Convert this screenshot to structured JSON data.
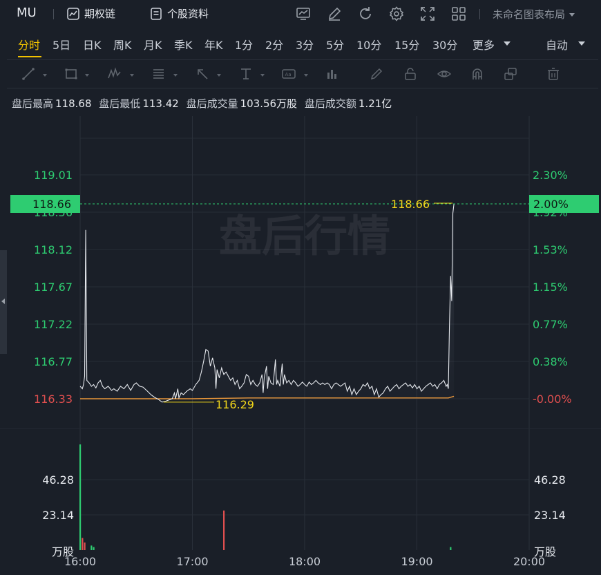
{
  "header": {
    "ticker": "MU",
    "options_chain_label": "期权链",
    "profile_label": "个股资料",
    "layout_name": "未命名图表布局"
  },
  "periods": {
    "tabs": [
      "分时",
      "5日",
      "日K",
      "周K",
      "月K",
      "季K",
      "年K",
      "1分",
      "2分",
      "3分",
      "5分",
      "10分",
      "15分",
      "30分",
      "更多"
    ],
    "active": "分时",
    "auto_label": "自动"
  },
  "drawing_tools": [
    "line-tool",
    "rect-tool",
    "wave-tool",
    "fib-tool",
    "arrow-tool",
    "text-tool",
    "label-tool",
    "bar-tool",
    "pen-tool",
    "lock-tool",
    "eye-tool",
    "magnet-tool",
    "layers-tool",
    "trash-tool"
  ],
  "info": {
    "high_label": "盘后最高",
    "high": "118.68",
    "low_label": "盘后最低",
    "low": "113.42",
    "vol_label": "盘后成交量",
    "vol": "103.56万股",
    "amount_label": "盘后成交额",
    "amount": "1.21亿"
  },
  "watermark": "盘后行情",
  "colors": {
    "up": "#2ecc71",
    "down": "#e04f4f",
    "price_line": "#e6e9ee",
    "avg_line": "#e8963a",
    "marker": "#f2d71a"
  },
  "chart_data": {
    "type": "line",
    "x_ticks": [
      "16:00",
      "17:00",
      "18:00",
      "19:00",
      "20:00"
    ],
    "x_range_hours": [
      16,
      20
    ],
    "price_axis": {
      "min": 116.33,
      "max": 119.01,
      "ticks": [
        "119.01",
        "118.56",
        "118.12",
        "117.67",
        "117.22",
        "116.77",
        "116.33"
      ],
      "pct_ticks": [
        "2.30%",
        "1.92%",
        "1.53%",
        "1.15%",
        "0.77%",
        "0.38%",
        "-0.00%"
      ],
      "pct_max": 2.3
    },
    "current_price": "118.66",
    "current_pct": "2.00%",
    "high_marker": "118.66",
    "low_marker": "116.29",
    "price_series": [
      [
        16.0,
        116.48
      ],
      [
        16.02,
        116.45
      ],
      [
        16.03,
        116.5
      ],
      [
        16.04,
        116.6
      ],
      [
        16.05,
        118.35
      ],
      [
        16.06,
        116.55
      ],
      [
        16.08,
        116.52
      ],
      [
        16.1,
        116.48
      ],
      [
        16.12,
        116.5
      ],
      [
        16.14,
        116.46
      ],
      [
        16.16,
        116.52
      ],
      [
        16.18,
        116.55
      ],
      [
        16.2,
        116.48
      ],
      [
        16.22,
        116.45
      ],
      [
        16.25,
        116.48
      ],
      [
        16.28,
        116.43
      ],
      [
        16.3,
        116.45
      ],
      [
        16.33,
        116.42
      ],
      [
        16.36,
        116.48
      ],
      [
        16.39,
        116.45
      ],
      [
        16.42,
        116.5
      ],
      [
        16.45,
        116.43
      ],
      [
        16.48,
        116.5
      ],
      [
        16.5,
        116.52
      ],
      [
        16.53,
        116.48
      ],
      [
        16.56,
        116.47
      ],
      [
        16.6,
        116.42
      ],
      [
        16.63,
        116.38
      ],
      [
        16.66,
        116.35
      ],
      [
        16.7,
        116.32
      ],
      [
        16.73,
        116.29
      ],
      [
        16.76,
        116.3
      ],
      [
        16.8,
        116.32
      ],
      [
        16.82,
        116.33
      ],
      [
        16.84,
        116.4
      ],
      [
        16.85,
        116.33
      ],
      [
        16.87,
        116.45
      ],
      [
        16.88,
        116.34
      ],
      [
        16.9,
        116.4
      ],
      [
        16.92,
        116.38
      ],
      [
        16.95,
        116.42
      ],
      [
        16.98,
        116.45
      ],
      [
        17.0,
        116.43
      ],
      [
        17.03,
        116.5
      ],
      [
        17.06,
        116.55
      ],
      [
        17.08,
        116.65
      ],
      [
        17.1,
        116.78
      ],
      [
        17.12,
        116.92
      ],
      [
        17.14,
        116.9
      ],
      [
        17.16,
        116.72
      ],
      [
        17.18,
        116.82
      ],
      [
        17.2,
        116.7
      ],
      [
        17.21,
        116.45
      ],
      [
        17.22,
        116.68
      ],
      [
        17.24,
        116.58
      ],
      [
        17.26,
        116.7
      ],
      [
        17.28,
        116.62
      ],
      [
        17.3,
        116.65
      ],
      [
        17.32,
        116.6
      ],
      [
        17.34,
        116.55
      ],
      [
        17.36,
        116.58
      ],
      [
        17.38,
        116.5
      ],
      [
        17.4,
        116.55
      ],
      [
        17.42,
        116.45
      ],
      [
        17.44,
        116.48
      ],
      [
        17.46,
        116.52
      ],
      [
        17.48,
        116.62
      ],
      [
        17.5,
        116.6
      ],
      [
        17.52,
        116.5
      ],
      [
        17.54,
        116.55
      ],
      [
        17.56,
        116.5
      ],
      [
        17.58,
        116.48
      ],
      [
        17.6,
        116.52
      ],
      [
        17.62,
        116.62
      ],
      [
        17.63,
        116.4
      ],
      [
        17.64,
        116.58
      ],
      [
        17.66,
        116.72
      ],
      [
        17.67,
        116.45
      ],
      [
        17.68,
        116.6
      ],
      [
        17.7,
        116.52
      ],
      [
        17.72,
        116.5
      ],
      [
        17.74,
        116.8
      ],
      [
        17.75,
        116.5
      ],
      [
        17.76,
        116.55
      ],
      [
        17.78,
        116.48
      ],
      [
        17.8,
        116.75
      ],
      [
        17.81,
        116.5
      ],
      [
        17.82,
        116.62
      ],
      [
        17.84,
        116.52
      ],
      [
        17.86,
        116.55
      ],
      [
        17.88,
        116.5
      ],
      [
        17.9,
        116.55
      ],
      [
        17.92,
        116.52
      ],
      [
        17.94,
        116.48
      ],
      [
        17.96,
        116.5
      ],
      [
        17.98,
        116.53
      ],
      [
        18.0,
        116.5
      ],
      [
        18.02,
        116.48
      ],
      [
        18.04,
        116.53
      ],
      [
        18.06,
        116.5
      ],
      [
        18.08,
        116.52
      ],
      [
        18.1,
        116.55
      ],
      [
        18.12,
        116.52
      ],
      [
        18.14,
        116.5
      ],
      [
        18.16,
        116.52
      ],
      [
        18.18,
        116.5
      ],
      [
        18.2,
        116.52
      ],
      [
        18.22,
        116.5
      ],
      [
        18.24,
        116.45
      ],
      [
        18.26,
        116.5
      ],
      [
        18.28,
        116.52
      ],
      [
        18.3,
        116.5
      ],
      [
        18.32,
        116.48
      ],
      [
        18.34,
        116.5
      ],
      [
        18.36,
        116.52
      ],
      [
        18.38,
        116.42
      ],
      [
        18.4,
        116.48
      ],
      [
        18.42,
        116.38
      ],
      [
        18.44,
        116.45
      ],
      [
        18.46,
        116.38
      ],
      [
        18.48,
        116.42
      ],
      [
        18.5,
        116.45
      ],
      [
        18.52,
        116.5
      ],
      [
        18.54,
        116.48
      ],
      [
        18.56,
        116.52
      ],
      [
        18.58,
        116.45
      ],
      [
        18.6,
        116.48
      ],
      [
        18.62,
        116.38
      ],
      [
        18.64,
        116.45
      ],
      [
        18.66,
        116.35
      ],
      [
        18.68,
        116.38
      ],
      [
        18.7,
        116.4
      ],
      [
        18.72,
        116.45
      ],
      [
        18.74,
        116.48
      ],
      [
        18.76,
        116.42
      ],
      [
        18.78,
        116.45
      ],
      [
        18.8,
        116.48
      ],
      [
        18.82,
        116.5
      ],
      [
        18.84,
        116.45
      ],
      [
        18.86,
        116.48
      ],
      [
        18.88,
        116.5
      ],
      [
        18.9,
        116.52
      ],
      [
        18.92,
        116.48
      ],
      [
        18.94,
        116.5
      ],
      [
        18.96,
        116.46
      ],
      [
        18.98,
        116.5
      ],
      [
        19.0,
        116.45
      ],
      [
        19.02,
        116.48
      ],
      [
        19.04,
        116.42
      ],
      [
        19.06,
        116.45
      ],
      [
        19.08,
        116.48
      ],
      [
        19.1,
        116.5
      ],
      [
        19.12,
        116.52
      ],
      [
        19.14,
        116.48
      ],
      [
        19.16,
        116.5
      ],
      [
        19.18,
        116.45
      ],
      [
        19.2,
        116.5
      ],
      [
        19.22,
        116.52
      ],
      [
        19.24,
        116.55
      ],
      [
        19.26,
        116.48
      ],
      [
        19.27,
        116.5
      ],
      [
        19.28,
        116.45
      ],
      [
        19.29,
        117.2
      ],
      [
        19.3,
        117.8
      ],
      [
        19.31,
        117.5
      ],
      [
        19.32,
        118.55
      ],
      [
        19.33,
        118.66
      ]
    ],
    "avg_series": [
      [
        16.0,
        116.33
      ],
      [
        16.5,
        116.33
      ],
      [
        17.0,
        116.33
      ],
      [
        17.5,
        116.34
      ],
      [
        18.0,
        116.34
      ],
      [
        18.5,
        116.34
      ],
      [
        19.0,
        116.34
      ],
      [
        19.28,
        116.34
      ],
      [
        19.33,
        116.36
      ]
    ],
    "volume_axis": {
      "max": 69.42,
      "ticks": [
        "46.28",
        "23.14"
      ],
      "unit": "万股"
    },
    "volume_bars": [
      {
        "t": 16.0,
        "v": 69.4,
        "dir": "up"
      },
      {
        "t": 16.02,
        "v": 8.0,
        "dir": "down"
      },
      {
        "t": 16.04,
        "v": 5.0,
        "dir": "down"
      },
      {
        "t": 16.1,
        "v": 3.0,
        "dir": "up"
      },
      {
        "t": 16.12,
        "v": 2.0,
        "dir": "up"
      },
      {
        "t": 17.28,
        "v": 26.0,
        "dir": "down"
      },
      {
        "t": 19.3,
        "v": 2.0,
        "dir": "up"
      }
    ]
  }
}
